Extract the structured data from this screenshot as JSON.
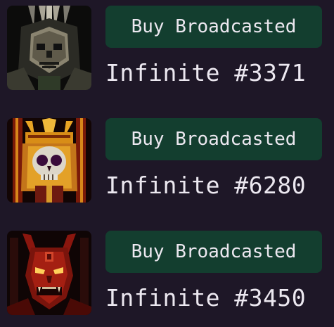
{
  "items": [
    {
      "button_label": "Buy Broadcasted",
      "title": "Infinite #3371",
      "art": "dark-armored-skull-knight"
    },
    {
      "button_label": "Buy Broadcasted",
      "title": "Infinite #6280",
      "art": "golden-crowned-skull"
    },
    {
      "button_label": "Buy Broadcasted",
      "title": "Infinite #3450",
      "art": "red-horned-demon"
    }
  ],
  "colors": {
    "background": "#1e1727",
    "button_bg": "#133e2f",
    "text": "#ece8f0"
  }
}
